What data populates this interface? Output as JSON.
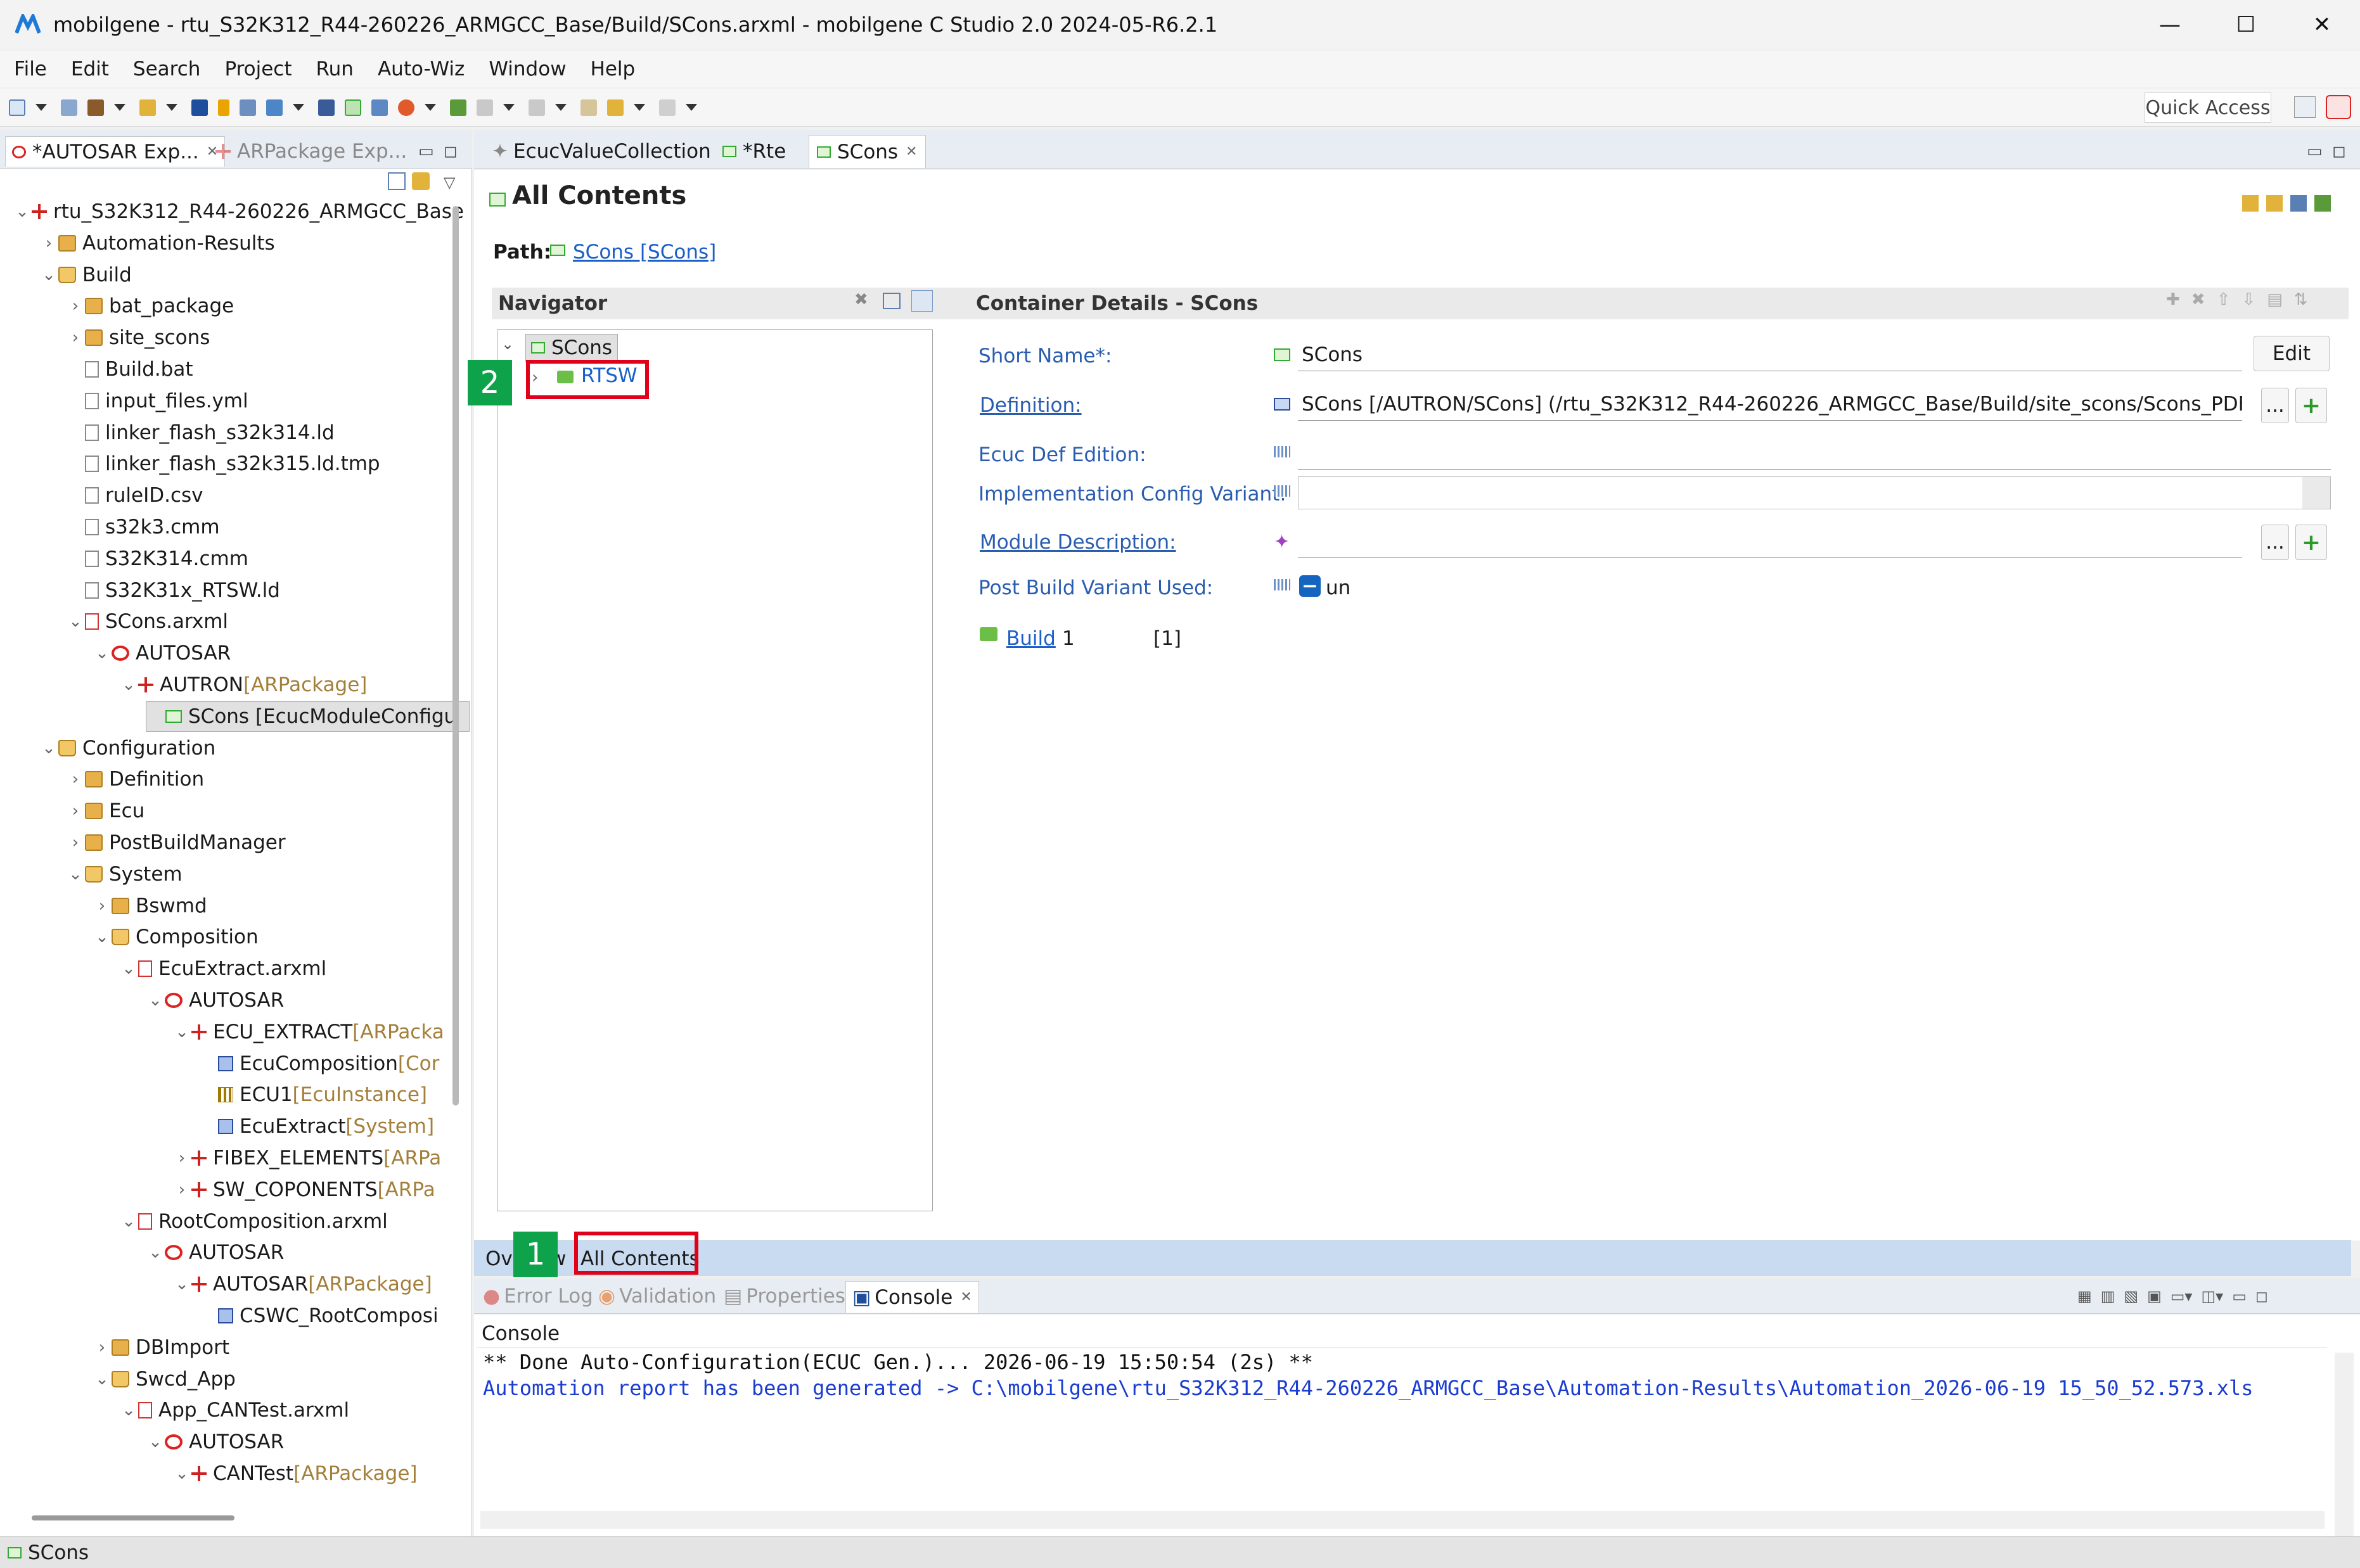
{
  "window": {
    "title": "mobilgene - rtu_S32K312_R44-260226_ARMGCC_Base/Build/SCons.arxml - mobilgene C Studio 2.0 2024-05-R6.2.1",
    "minimize": "—",
    "maximize": "☐",
    "close": "✕"
  },
  "menu": [
    "File",
    "Edit",
    "Search",
    "Project",
    "Run",
    "Auto-Wiz",
    "Window",
    "Help"
  ],
  "quick_access": "Quick Access",
  "left_tabs": [
    {
      "label": "*AUTOSAR Exp...",
      "active": true
    },
    {
      "label": "ARPackage Exp...",
      "active": false
    }
  ],
  "tree": [
    {
      "label": "rtu_S32K312_R44-260226_ARMGCC_Base",
      "suffix": "",
      "icon": "project-icon",
      "chev": "v"
    },
    {
      "label": "Automation-Results",
      "suffix": "",
      "icon": "folder-icon",
      "chev": ">"
    },
    {
      "label": "Build",
      "suffix": "",
      "icon": "folder-open-icon",
      "chev": "v"
    },
    {
      "label": "bat_package",
      "suffix": "",
      "icon": "folder-icon",
      "chev": ">"
    },
    {
      "label": "site_scons",
      "suffix": "",
      "icon": "folder-icon",
      "chev": ">"
    },
    {
      "label": "Build.bat",
      "suffix": "",
      "icon": "file-icon",
      "chev": ""
    },
    {
      "label": "input_files.yml",
      "suffix": "",
      "icon": "file-icon",
      "chev": ""
    },
    {
      "label": "linker_flash_s32k314.ld",
      "suffix": "",
      "icon": "file-icon",
      "chev": ""
    },
    {
      "label": "linker_flash_s32k315.ld.tmp",
      "suffix": "",
      "icon": "file-icon",
      "chev": ""
    },
    {
      "label": "ruleID.csv",
      "suffix": "",
      "icon": "file-icon",
      "chev": ""
    },
    {
      "label": "s32k3.cmm",
      "suffix": "",
      "icon": "file-icon",
      "chev": ""
    },
    {
      "label": "S32K314.cmm",
      "suffix": "",
      "icon": "file-icon",
      "chev": ""
    },
    {
      "label": "S32K31x_RTSW.ld",
      "suffix": "",
      "icon": "file-icon",
      "chev": ""
    },
    {
      "label": "SCons.arxml",
      "suffix": "",
      "icon": "arxml-icon",
      "chev": "v"
    },
    {
      "label": "AUTOSAR",
      "suffix": "",
      "icon": "autosar-icon",
      "chev": "v"
    },
    {
      "label": "AUTRON",
      "suffix": " [ARPackage]",
      "icon": "package-icon",
      "chev": "v"
    },
    {
      "label": "SCons [EcucModuleConfigu",
      "suffix": "",
      "icon": "module-config-icon",
      "chev": ""
    },
    {
      "label": "Configuration",
      "suffix": "",
      "icon": "folder-open-icon",
      "chev": "v"
    },
    {
      "label": "Definition",
      "suffix": "",
      "icon": "folder-icon",
      "chev": ">"
    },
    {
      "label": "Ecu",
      "suffix": "",
      "icon": "folder-icon",
      "chev": ">"
    },
    {
      "label": "PostBuildManager",
      "suffix": "",
      "icon": "folder-icon",
      "chev": ">"
    },
    {
      "label": "System",
      "suffix": "",
      "icon": "folder-open-icon",
      "chev": "v"
    },
    {
      "label": "Bswmd",
      "suffix": "",
      "icon": "folder-icon",
      "chev": ">"
    },
    {
      "label": "Composition",
      "suffix": "",
      "icon": "folder-open-icon",
      "chev": "v"
    },
    {
      "label": "EcuExtract.arxml",
      "suffix": "",
      "icon": "arxml-icon",
      "chev": "v"
    },
    {
      "label": "AUTOSAR",
      "suffix": "",
      "icon": "autosar-icon",
      "chev": "v"
    },
    {
      "label": "ECU_EXTRACT",
      "suffix": " [ARPacka",
      "icon": "package-icon",
      "chev": "v"
    },
    {
      "label": "EcuComposition",
      "suffix": " [Cor",
      "icon": "ecu-composition-icon",
      "chev": ""
    },
    {
      "label": "ECU1",
      "suffix": " [EcuInstance]",
      "icon": "ecu-instance-icon",
      "chev": ""
    },
    {
      "label": "EcuExtract",
      "suffix": " [System]",
      "icon": "system-icon",
      "chev": ""
    },
    {
      "label": "FIBEX_ELEMENTS",
      "suffix": " [ARPa",
      "icon": "package-icon",
      "chev": ">"
    },
    {
      "label": "SW_COPONENTS",
      "suffix": " [ARPa",
      "icon": "package-icon",
      "chev": ">"
    },
    {
      "label": "RootComposition.arxml",
      "suffix": "",
      "icon": "arxml-icon",
      "chev": "v"
    },
    {
      "label": "AUTOSAR",
      "suffix": "",
      "icon": "autosar-icon",
      "chev": "v"
    },
    {
      "label": "AUTOSAR",
      "suffix": " [ARPackage]",
      "icon": "package-icon",
      "chev": "v"
    },
    {
      "label": "CSWC_RootComposi",
      "suffix": "",
      "icon": "ecu-composition-icon",
      "chev": ""
    },
    {
      "label": "DBImport",
      "suffix": "",
      "icon": "folder-icon",
      "chev": ">"
    },
    {
      "label": "Swcd_App",
      "suffix": "",
      "icon": "folder-open-icon",
      "chev": "v"
    },
    {
      "label": "App_CANTest.arxml",
      "suffix": "",
      "icon": "arxml-icon",
      "chev": "v"
    },
    {
      "label": "AUTOSAR",
      "suffix": "",
      "icon": "autosar-icon",
      "chev": "v"
    },
    {
      "label": "CANTest",
      "suffix": " [ARPackage]",
      "icon": "package-icon",
      "chev": "v"
    }
  ],
  "editor_tabs": [
    {
      "label": "EcucValueCollection",
      "active": false
    },
    {
      "label": "*Rte",
      "active": false
    },
    {
      "label": "SCons",
      "active": true
    }
  ],
  "editor": {
    "header": "All Contents",
    "path_label": "Path:",
    "path_value": "SCons [SCons]",
    "navigator_title": "Navigator",
    "nav_root": "SCons",
    "nav_child": "RTSW",
    "details_title": "Container Details - SCons",
    "short_name_label": "Short Name*:",
    "short_name_value": "SCons",
    "edit_button": "Edit",
    "definition_label": "Definition:",
    "definition_value": "SCons [/AUTRON/SCons] (/rtu_S32K312_R44-260226_ARMGCC_Base/Build/site_scons/Scons_PDF.arxml",
    "ecuc_def_label": "Ecuc Def Edition:",
    "impl_variant_label": "Implementation Config Variant:",
    "module_desc_label": "Module Description:",
    "post_build_label": "Post Build Variant Used:",
    "post_build_value": "un",
    "build_link": "Build",
    "build_count": "1",
    "build_mult": "[1]",
    "ellipsis": "...",
    "plus": "+"
  },
  "bottom_editor_tabs": [
    "Ov",
    "w",
    "All Contents"
  ],
  "annotations": {
    "one": "1",
    "two": "2"
  },
  "bottom_tabs": [
    {
      "label": "Error Log",
      "active": false
    },
    {
      "label": "Validation",
      "active": false
    },
    {
      "label": "Properties",
      "active": false
    },
    {
      "label": "Console",
      "active": true
    }
  ],
  "console": {
    "title": "Console",
    "line1": "** Done Auto-Configuration(ECUC Gen.)... 2026-06-19 15:50:54 (2s) **",
    "line2": "Automation report has been generated -> C:\\mobilgene\\rtu_S32K312_R44-260226_ARMGCC_Base\\Automation-Results\\Automation_2026-06-19 15_50_52.573.xls"
  },
  "status": "SCons",
  "colors": {
    "link": "#1a5fc8",
    "highlight": "#e0001a",
    "badge": "#0ea34a"
  }
}
